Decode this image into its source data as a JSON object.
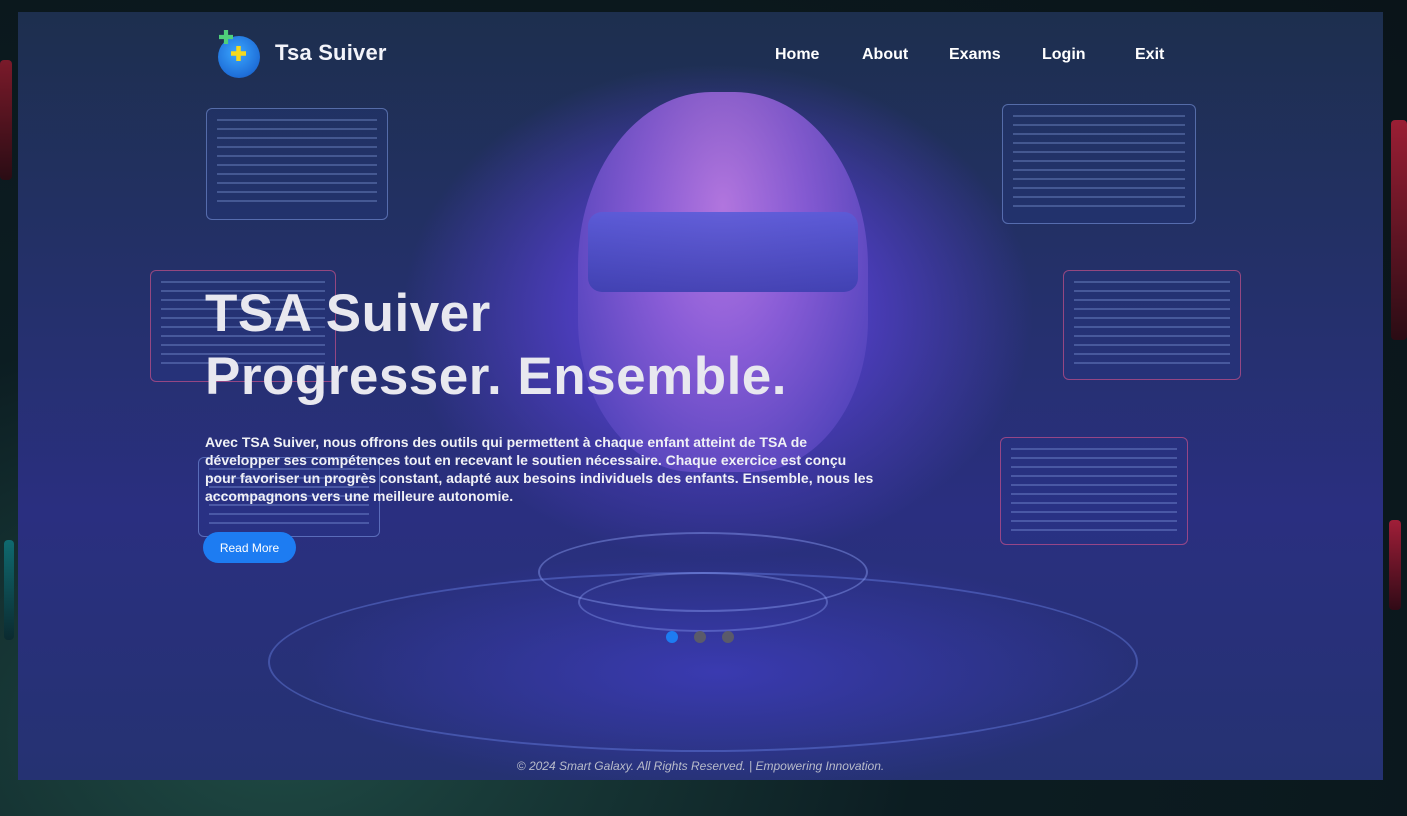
{
  "brand": {
    "name": "Tsa Suiver",
    "logo_icon": "puzzle-head-logo-icon"
  },
  "nav": {
    "items": [
      {
        "label": "Home"
      },
      {
        "label": "About"
      },
      {
        "label": "Exams"
      },
      {
        "label": "Login"
      },
      {
        "label": "Exit"
      }
    ]
  },
  "hero": {
    "title_line1": "TSA Suiver",
    "title_line2": "Progresser. Ensemble.",
    "description": "Avec TSA Suiver, nous offrons des outils qui permettent à chaque enfant atteint de TSA de développer ses compétences tout en recevant le soutien nécessaire. Chaque exercice est conçu pour favoriser un progrès constant, adapté aux besoins individuels des enfants. Ensemble, nous les accompagnons vers une meilleure autonomie.",
    "cta_label": "Read More"
  },
  "carousel": {
    "slides": 3,
    "active_index": 0
  },
  "footer": {
    "text": "© 2024 Smart Galaxy. All Rights Reserved. | Empowering Innovation."
  },
  "colors": {
    "accent": "#1d7cf2",
    "title": "#e8e8ef",
    "inactive_dot": "#5a5a6a"
  }
}
